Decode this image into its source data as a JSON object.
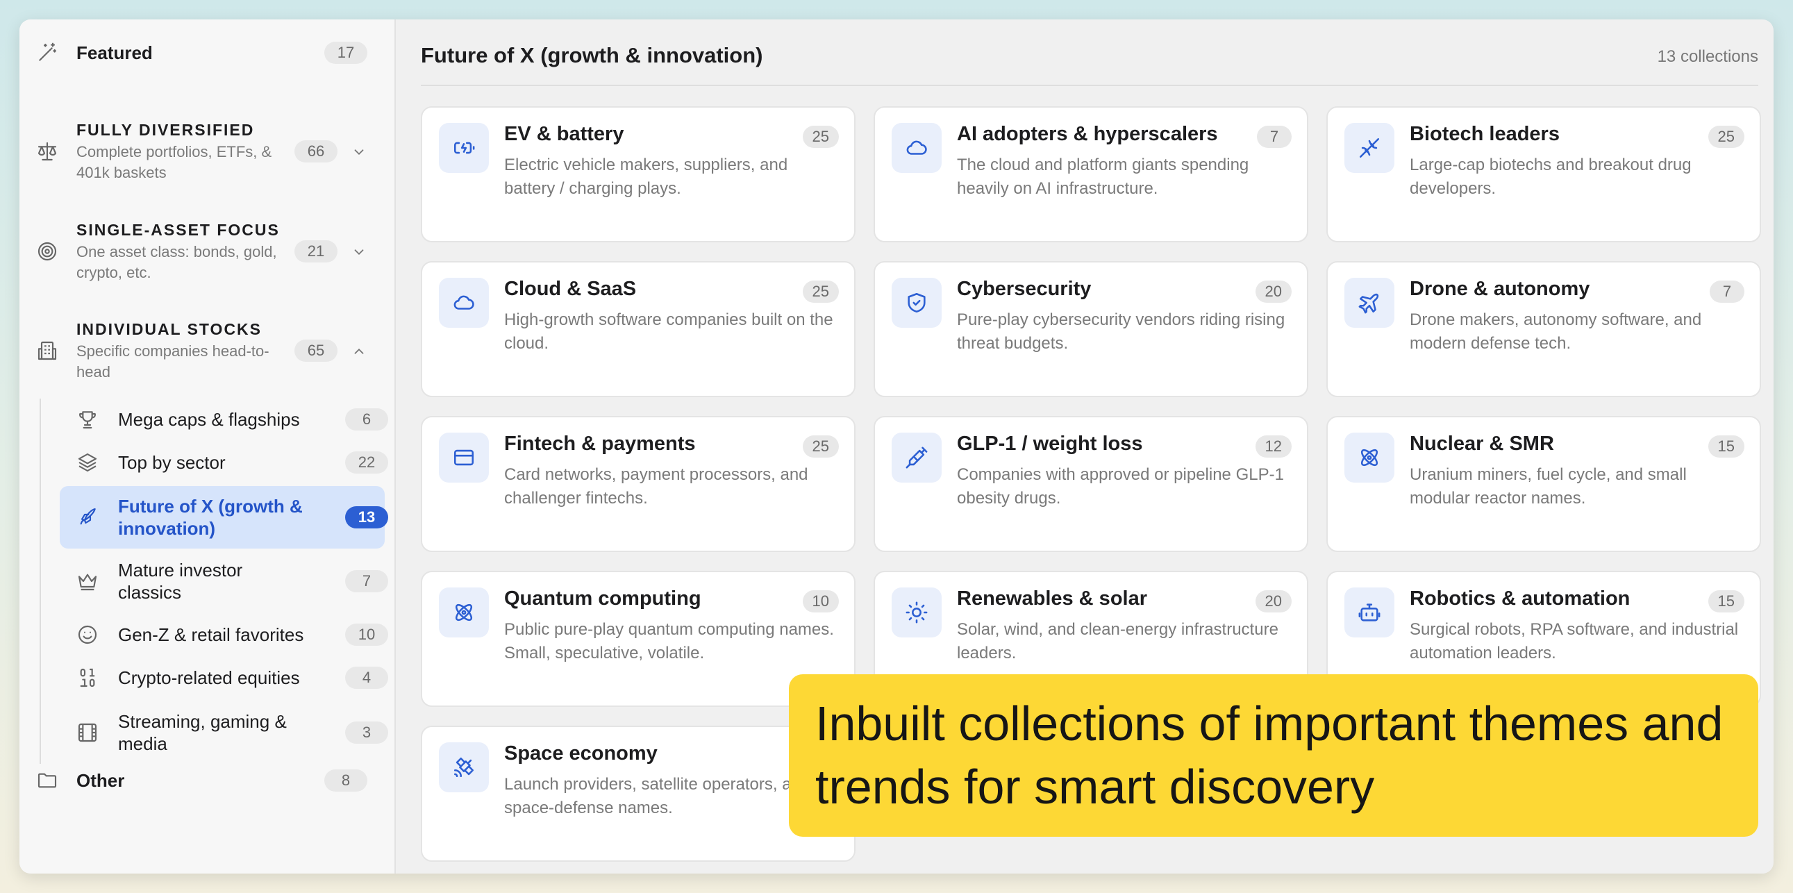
{
  "sidebar": {
    "featured": {
      "label": "Featured",
      "count": "17"
    },
    "groups": [
      {
        "title": "FULLY DIVERSIFIED",
        "desc": "Complete portfolios, ETFs, & 401k baskets",
        "count": "66"
      },
      {
        "title": "SINGLE-ASSET FOCUS",
        "desc": "One asset class: bonds, gold, crypto, etc.",
        "count": "21"
      },
      {
        "title": "INDIVIDUAL STOCKS",
        "desc": "Specific companies head-to-head",
        "count": "65"
      }
    ],
    "sub_items": [
      {
        "label": "Mega caps & flagships",
        "count": "6",
        "icon": "trophy-icon"
      },
      {
        "label": "Top by sector",
        "count": "22",
        "icon": "layers-icon"
      },
      {
        "label": "Future of X (growth & innovation)",
        "count": "13",
        "icon": "rocket-icon",
        "active": true
      },
      {
        "label": "Mature investor classics",
        "count": "7",
        "icon": "crown-icon"
      },
      {
        "label": "Gen-Z & retail favorites",
        "count": "10",
        "icon": "smile-icon"
      },
      {
        "label": "Crypto-related equities",
        "count": "4",
        "icon": "binary-icon"
      },
      {
        "label": "Streaming, gaming & media",
        "count": "3",
        "icon": "film-icon"
      }
    ],
    "other": {
      "label": "Other",
      "count": "8"
    }
  },
  "main": {
    "title": "Future of X (growth & innovation)",
    "collections_count": "13 collections",
    "cards": [
      {
        "title": "EV & battery",
        "desc": "Electric vehicle makers, suppliers, and battery / charging plays.",
        "count": "25",
        "icon": "battery-icon"
      },
      {
        "title": "AI adopters & hyperscalers",
        "desc": "The cloud and platform giants spending heavily on AI infrastructure.",
        "count": "7",
        "icon": "cloud-icon"
      },
      {
        "title": "Biotech leaders",
        "desc": "Large-cap biotechs and breakout drug developers.",
        "count": "25",
        "icon": "dna-icon"
      },
      {
        "title": "Cloud & SaaS",
        "desc": "High-growth software companies built on the cloud.",
        "count": "25",
        "icon": "cloud-icon"
      },
      {
        "title": "Cybersecurity",
        "desc": "Pure-play cybersecurity vendors riding rising threat budgets.",
        "count": "20",
        "icon": "shield-check-icon"
      },
      {
        "title": "Drone & autonomy",
        "desc": "Drone makers, autonomy software, and modern defense tech.",
        "count": "7",
        "icon": "plane-icon"
      },
      {
        "title": "Fintech & payments",
        "desc": "Card networks, payment processors, and challenger fintechs.",
        "count": "25",
        "icon": "credit-card-icon"
      },
      {
        "title": "GLP-1 / weight loss",
        "desc": "Companies with approved or pipeline GLP-1 obesity drugs.",
        "count": "12",
        "icon": "syringe-icon"
      },
      {
        "title": "Nuclear & SMR",
        "desc": "Uranium miners, fuel cycle, and small modular reactor names.",
        "count": "15",
        "icon": "atom-icon"
      },
      {
        "title": "Quantum computing",
        "desc": "Public pure-play quantum computing names. Small, speculative, volatile.",
        "count": "10",
        "icon": "atom-icon"
      },
      {
        "title": "Renewables & solar",
        "desc": "Solar, wind, and clean-energy infrastructure leaders.",
        "count": "20",
        "icon": "sun-icon"
      },
      {
        "title": "Robotics & automation",
        "desc": "Surgical robots, RPA software, and industrial automation leaders.",
        "count": "15",
        "icon": "bot-icon"
      },
      {
        "title": "Space economy",
        "desc": "Launch providers, satellite operators, and space-defense names.",
        "count": "",
        "icon": "satellite-icon"
      }
    ]
  },
  "banner": {
    "text": "Inbuilt collections of important themes and trends for smart discovery"
  },
  "colors": {
    "accent": "#2c5fd3",
    "active_bg": "#d6e4fb",
    "banner": "#fdd835"
  }
}
